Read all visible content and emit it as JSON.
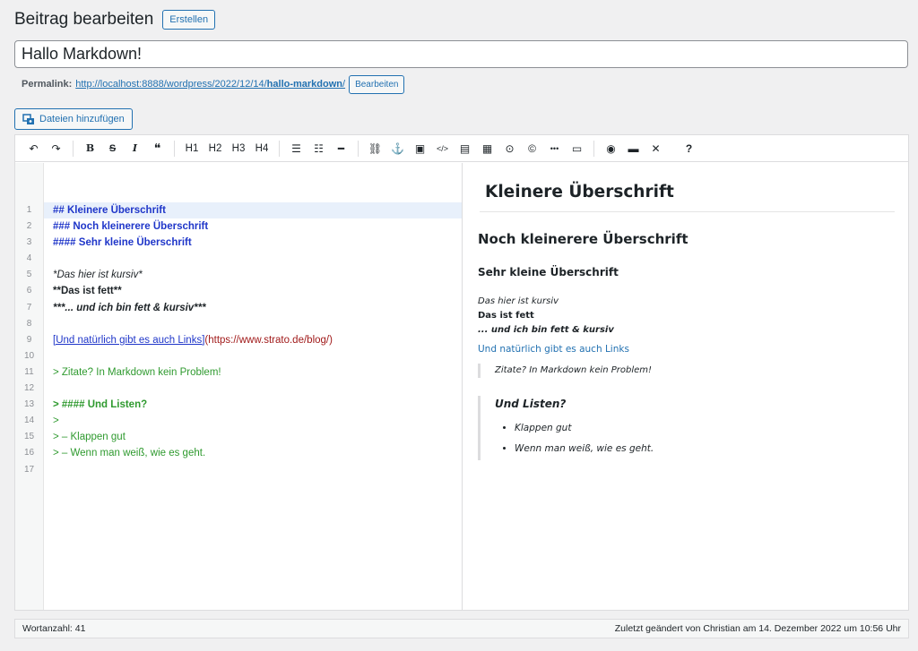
{
  "header": {
    "title": "Beitrag bearbeiten",
    "create_label": "Erstellen"
  },
  "post": {
    "title": "Hallo Markdown!"
  },
  "permalink": {
    "label": "Permalink:",
    "url_base": "http://localhost:8888/wordpress/2022/12/14/",
    "url_slug": "hallo-markdown",
    "url_trailing": "/",
    "edit_label": "Bearbeiten"
  },
  "media": {
    "label": "Dateien hinzufügen"
  },
  "toolbar": {
    "undo": "↶",
    "redo": "↷",
    "bold": "B",
    "strikethrough": "S",
    "italic": "I",
    "quote": "❝",
    "h1": "H1",
    "h2": "H2",
    "h3": "H3",
    "h4": "H4",
    "ul": "☰",
    "ol": "☷",
    "hr": "━",
    "link": "⛓",
    "anchor": "⚓",
    "image": "▣",
    "code": "</>",
    "file": "▤",
    "table": "▦",
    "clock": "⊙",
    "copyright": "©",
    "more": "•••",
    "card": "▭",
    "preview": "◉",
    "monitor": "▬",
    "fullscreen": "✕",
    "help": "?"
  },
  "editor": {
    "line_numbers": [
      "1",
      "2",
      "3",
      "4",
      "5",
      "6",
      "7",
      "8",
      "9",
      "10",
      "11",
      "12",
      "13",
      "14",
      "15",
      "16",
      "17"
    ],
    "lines": {
      "l1": "## Kleinere Überschrift",
      "l2": "### Noch kleinerere Überschrift",
      "l3": "#### Sehr kleine Überschrift",
      "l5": "*Das hier ist kursiv*",
      "l6": "**Das ist fett**",
      "l7": "***... und ich bin fett & kursiv***",
      "l9_text": "[Und natürlich gibt es auch Links]",
      "l9_url": "(https://www.strato.de/blog/)",
      "l11": "> Zitate? In Markdown kein Problem!",
      "l13": "> #### Und Listen?",
      "l14": ">",
      "l15": "> – Klappen gut",
      "l16": "> – Wenn man weiß, wie es geht."
    }
  },
  "preview": {
    "h2": "Kleinere Überschrift",
    "h3": "Noch kleinerere Überschrift",
    "h4": "Sehr kleine Überschrift",
    "p_italic": "Das hier ist kursiv",
    "p_bold": "Das ist fett",
    "p_bolditalic": "... und ich bin fett & kursiv",
    "link": "Und natürlich gibt es auch Links",
    "quote1": "Zitate? In Markdown kein Problem!",
    "quote2_heading": "Und Listen?",
    "list": [
      "Klappen gut",
      "Wenn man weiß, wie es geht."
    ]
  },
  "status": {
    "word_count": "Wortanzahl: 41",
    "last_edited": "Zuletzt geändert von Christian am 14. Dezember 2022 um 10:56 Uhr"
  }
}
